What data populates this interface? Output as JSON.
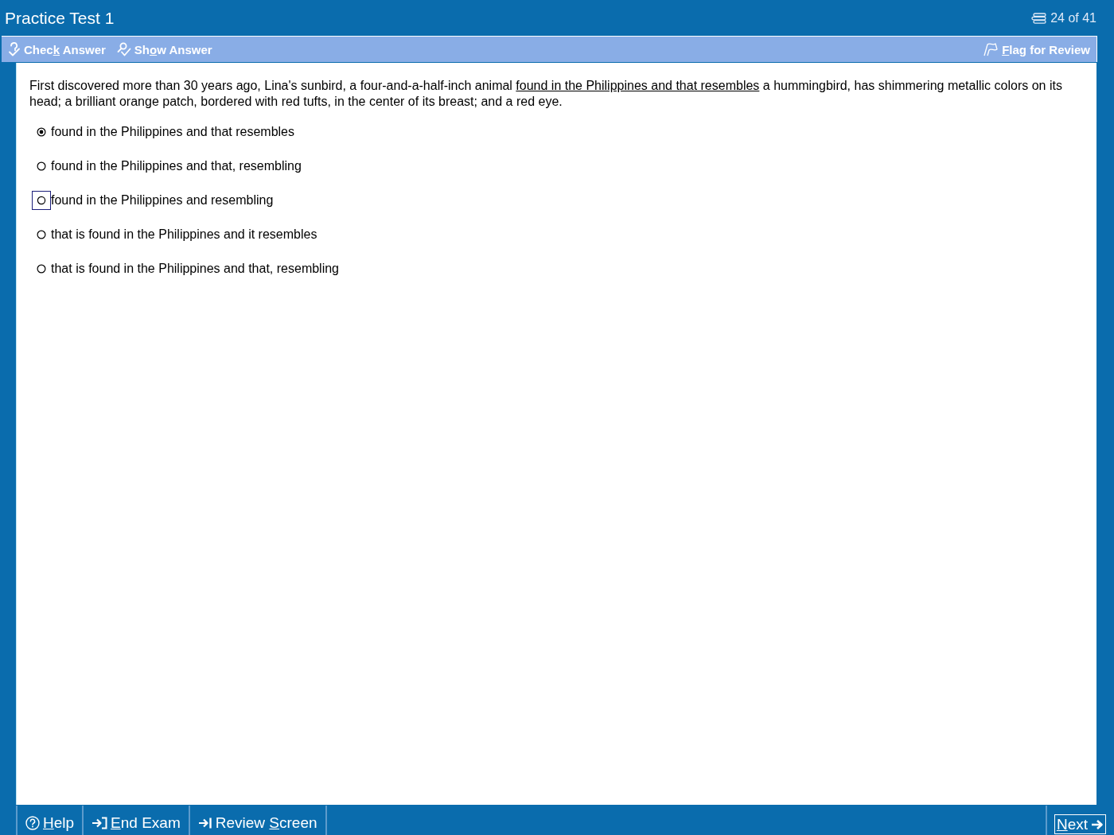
{
  "window": {
    "title": "Practice Test 1",
    "counter": "24 of 41"
  },
  "toolbar": {
    "left_buttons": [
      {
        "kind": "check",
        "label_before": "Chec",
        "access_key": "k",
        "label_after": " Answer"
      },
      {
        "kind": "show",
        "label_before": "Sh",
        "access_key": "o",
        "label_after": "w Answer"
      }
    ],
    "right_buttons": [
      {
        "kind": "flag",
        "access_key": "F",
        "label_after": "lag for Review"
      }
    ]
  },
  "question": {
    "passage": {
      "before": "First discovered more than 30 years ago, Lina's sunbird, a four-and-a-half-inch animal ",
      "underlined": "found in the Philippines and that resembles",
      "after": " a hummingbird, has shimmering metallic colors on its head; a brilliant orange patch, bordered with red tufts, in the center of its breast; and a red eye."
    },
    "options": [
      {
        "text": "found in the Philippines and that resembles",
        "selected": true,
        "focused": false
      },
      {
        "text": "found in the Philippines and that, resembling",
        "selected": false,
        "focused": false
      },
      {
        "text": "found in the Philippines and resembling",
        "selected": false,
        "focused": true
      },
      {
        "text": "that is found in the Philippines and it resembles",
        "selected": false,
        "focused": false
      },
      {
        "text": "that is found in the Philippines and that, resembling",
        "selected": false,
        "focused": false
      }
    ]
  },
  "footer": {
    "buttons": [
      {
        "kind": "help",
        "access_key": "H",
        "label_after": "elp"
      },
      {
        "kind": "end",
        "access_key": "E",
        "label_after": "nd Exam"
      },
      {
        "kind": "review",
        "label_before": "Review ",
        "access_key": "S",
        "label_after": "creen"
      }
    ],
    "next_button": {
      "kind": "next",
      "access_key": "N",
      "label_after": "ext"
    }
  }
}
